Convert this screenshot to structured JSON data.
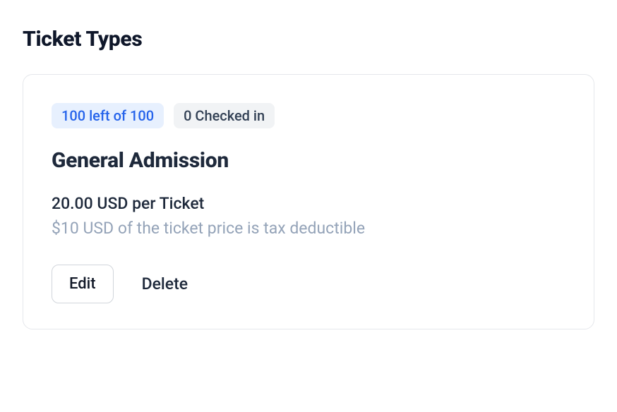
{
  "page": {
    "title": "Ticket Types"
  },
  "tickets": [
    {
      "availability": "100 left of 100",
      "checked_in": "0 Checked in",
      "name": "General Admission",
      "price": "20.00 USD per Ticket",
      "deductible": "$10 USD of the ticket price is tax deductible",
      "edit_label": "Edit",
      "delete_label": "Delete"
    }
  ]
}
